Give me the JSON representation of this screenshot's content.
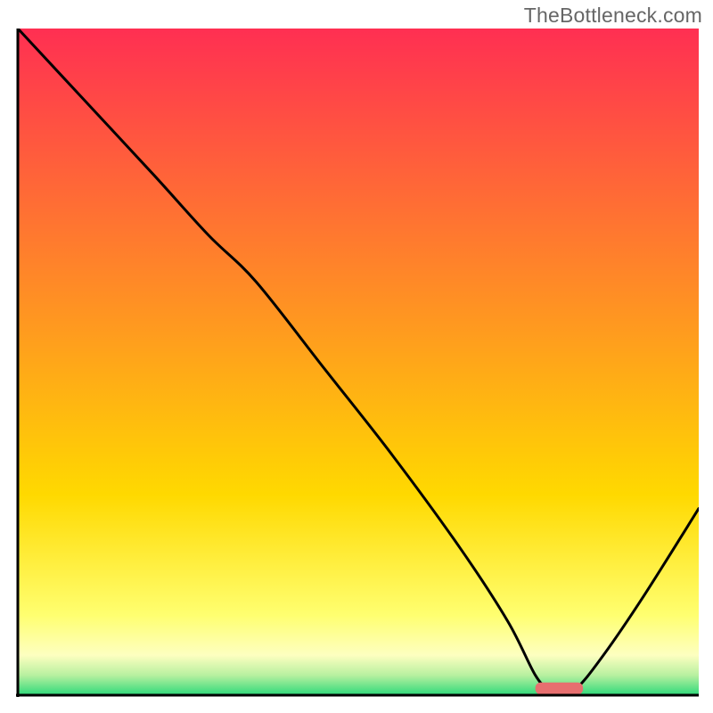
{
  "watermark": "TheBottleneck.com",
  "chart_data": {
    "type": "line",
    "title": "",
    "xlabel": "",
    "ylabel": "",
    "xlim": [
      0,
      100
    ],
    "ylim": [
      0,
      100
    ],
    "grid": false,
    "legend": false,
    "background_gradient_top": "#ff2f52",
    "background_gradient_mid": "#ffd900",
    "background_gradient_lowband": "#ffff9a",
    "background_gradient_bottom": "#2ed97a",
    "series": [
      {
        "name": "bottleneck-curve",
        "color": "#000000",
        "x": [
          0,
          10,
          20,
          28,
          35,
          45,
          55,
          65,
          72,
          76,
          78,
          80,
          82,
          86,
          92,
          100
        ],
        "y": [
          100,
          89,
          78,
          69,
          62,
          49,
          36,
          22,
          11,
          3,
          1,
          1,
          1,
          6,
          15,
          28
        ]
      }
    ],
    "marker": {
      "name": "optimal-range-bar",
      "color": "#e76f6f",
      "x_start": 76,
      "x_end": 83,
      "y": 1,
      "thickness_pct": 1.8
    },
    "axes": {
      "visible": true,
      "color": "#000000",
      "width": 3
    }
  }
}
